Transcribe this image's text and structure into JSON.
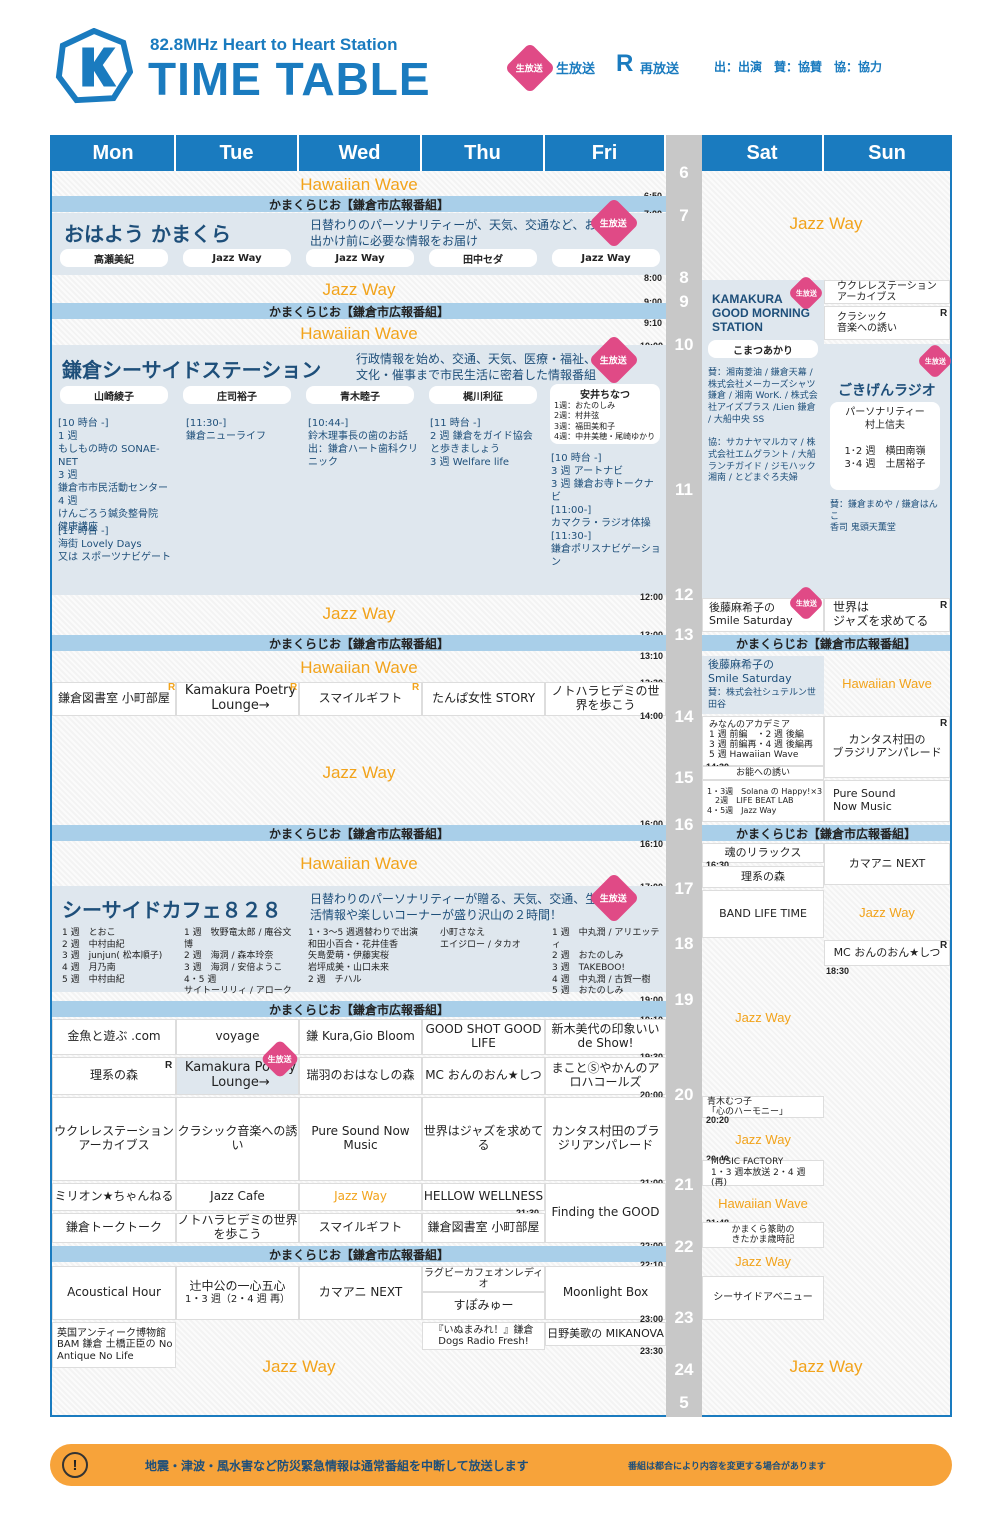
{
  "header": {
    "station": "82.8MHz Heart to Heart Station",
    "title": "TIME TABLE"
  },
  "legend": {
    "live_badge": "生放送",
    "live": "生放送",
    "rerun_mark": "R",
    "rerun": "再放送",
    "credits": "出：出演　賛：協賛　協：協力"
  },
  "days": [
    "Mon",
    "Tue",
    "Wed",
    "Thu",
    "Fri",
    "Sat",
    "Sun"
  ],
  "hours": [
    "6",
    "7",
    "8",
    "9",
    "10",
    "11",
    "12",
    "13",
    "14",
    "15",
    "16",
    "17",
    "18",
    "19",
    "20",
    "21",
    "22",
    "23",
    "24",
    "5"
  ],
  "times": {
    "t650": "6:50",
    "t700": "7:00",
    "t800": "8:00",
    "t900": "9:00",
    "t910": "9:10",
    "t1000": "10:00",
    "t1200": "12:00",
    "t1300": "13:00",
    "t1310": "13:10",
    "t1330": "13:30",
    "t1400": "14:00",
    "t1600": "16:00",
    "t1610": "16:10",
    "t1700": "17:00",
    "t1900": "19:00",
    "t1910": "19:10",
    "t1930": "19:30",
    "t2000": "20:00",
    "t2100": "21:00",
    "t2130": "21:30",
    "t2200": "22:00",
    "t2210": "22:10",
    "t2300": "23:00",
    "t2330": "23:30",
    "sat1430": "14:30",
    "sat1630": "16:30",
    "sun1830": "18:30",
    "sat2020": "20:20",
    "sat2040": "20:40",
    "sat2148": "21:48"
  },
  "common": {
    "hawaiian": "Hawaiian Wave",
    "jazz": "Jazz Way",
    "koho": "かまくらじお【鎌倉市広報番組】"
  },
  "morning": {
    "title": "おはよう かまくら",
    "desc": "日替わりのパーソナリティーが、天気、交通など、お出かけ前に必要な情報をお届け",
    "hosts": [
      "高瀬美紀",
      "Jazz Way",
      "Jazz Way",
      "田中セダ",
      "Jazz Way"
    ]
  },
  "seaside": {
    "title": "鎌倉シーサイドステーション",
    "desc": "行政情報を始め、交通、天気、医療・福祉、文化・催事まで市民生活に密着した情報番組",
    "hosts": [
      "山崎綾子",
      "庄司裕子",
      "青木睦子",
      "梶川利征",
      "安井ちなつ"
    ],
    "fri_weeks": "1週：おたのしみ\n2週：村井弦\n3週：福田美和子\n4週：中井美穂・尾崎ゆかり",
    "mon": "[10 時台 -]\n1 週\nもしもの時の SONAE-NET\n3 週\n鎌倉市市民活動センター\n4 週\nけんごろう鍼灸整骨院\n健康講座",
    "mon2": "[11 時台 -]\n海街 Lovely Days\n又は スポーツナビゲート",
    "tue": "[11:30-]\n鎌倉ニューライフ",
    "wed": "[10:44-]\n鈴木理事長の歯のお話\n出：鎌倉ハート歯科クリニック",
    "thu": "[11 時台 -]\n2 週 鎌倉をガイド協会と歩きましょう\n3 週 Welfare life",
    "fri": "[10 時台 -]\n3 週 アートナビ\n3 週 鎌倉お寺トークナビ\n[11:00-]\nカマクラ・ラジオ体操\n[11:30-]\n鎌倉ポリスナビゲーション"
  },
  "afternoon": {
    "mon": "鎌倉図書室 小町部屋",
    "tue": "Kamakura Poetry Lounge→",
    "wed": "スマイルギフト",
    "thu": "たんぱ女性 STORY",
    "fri": "ノトハラヒデミの世界を歩こう"
  },
  "cafe": {
    "title": "シーサイドカフェ８２８",
    "desc": "日替わりのパーソナリティーが贈る、天気、交通、生活情報や楽しいコーナーが盛り沢山の２時間！",
    "mon": "1 週　とおこ\n2 週　中村由紀\n3 週　junjun( 松本順子)\n4 週　月乃南\n5 週　中村由紀",
    "tue": "1 週　牧野竜太郎 / 庵谷文博\n2 週　海洞 / 森本玲奈\n3 週　海洞 / 安倍ようこ\n4・5 週\nサイトーリリィ / アローク",
    "wed": "1・3～5 週週替わりで出演\n和田小百合・花井佳香\n矢島愛萌・伊藤実桜\n岩坪成美・山口未来\n2 週　チハル",
    "thu": "小町さなえ\nエイジロー / タカオ",
    "fri": "1 週　中丸潤 / アリエッティ\n2 週　おたのしみ\n3 週　TAKEBOO!\n4 週　中丸潤 / 古賀一樹\n5 週　おたのしみ"
  },
  "evening": {
    "r1": [
      "金魚と遊ぶ .com",
      "voyage",
      "鎌 Kura,Gio Bloom",
      "GOOD SHOT GOOD LIFE",
      "新木美代の印象いいde Show!"
    ],
    "r2": [
      "理系の森",
      "Kamakura Poetry Lounge→",
      "瑞羽のおはなしの森",
      "MC おんのおん★しつ",
      "まことⓈやかんのアロハコールズ"
    ],
    "r3": [
      "ウクレレステーションアーカイブス",
      "クラシック音楽への誘い",
      "Pure Sound Now Music",
      "世界はジャズを求めてる",
      "カンタス村田のブラジリアンパレード"
    ],
    "r4": [
      "ミリオン★ちゃんねる",
      "Jazz Cafe",
      "Jazz Way",
      "HELLOW WELLNESS",
      "Finding the GOOD"
    ],
    "r5": [
      "鎌倉トークトーク",
      "ノトハラヒデミの世界を歩こう",
      "スマイルギフト",
      "鎌倉図書室 小町部屋"
    ],
    "r6": [
      "Acoustical Hour",
      "辻中公の一心五心",
      "カマアニ NEXT",
      "ラグビーカフェオンレディオ",
      "Moonlight Box"
    ],
    "tue_sub": "1・3 週（2・4 週 再）",
    "thu2": "すぽみゅー",
    "r7": [
      "英国アンティーク博物館 BAM 鎌倉 土橋正臣の No Antique No Life",
      "『いぬまみれ！』鎌倉 Dogs Radio Fresh!",
      "日野美歌の MIKANOVA"
    ]
  },
  "sat": {
    "kgm": "KAMAKURA GOOD MORNING STATION",
    "kgm_host": "こまつあかり",
    "kgm_spon": "賛：湘南菱油 / 鎌倉天幕 / 株式会社メーカーズシャツ鎌倉 / 湘南 WorK. / 株式会社アイズプラス /Lien 鎌倉 / 大船中央 SS\n\n協：サカナヤマルカマ / 株式会社エムグラント / 大船ランチガイド / ジモハック湘南 / とどまぐろ夫婦",
    "smile1": "後藤麻希子の\nSmile Saturday",
    "smile2": "後藤麻希子の\nSmile Saturday",
    "smile_spon": "賛：株式会社シュテルン世田谷",
    "academy": "みなんのアカデミア\n1 週 前編　・2 週 後編\n3 週 前編再・4 週 後編再\n5 週 Hawaiian Wave",
    "noh": "お能への誘い",
    "solana": "1・3週　Solana の Happy!×3\n　2週　LIFE BEAT LAB\n4・5週　Jazz Way",
    "relax": "魂のリラックス",
    "rikei": "理系の森",
    "band": "BAND LIFE TIME",
    "aoki": "青木むつ子\n「心のハーモニー」",
    "mf": "MUSIC FACTORY\n1・3 週本放送 2・4 週 (再)",
    "kizuna": "かまくら篆助の\nきたかま歳時記",
    "avenue": "シーサイドアベニュー"
  },
  "sun": {
    "uku": "ウクレレステーション\nアーカイブス",
    "classic": "クラシック\n音楽への誘い",
    "gokigen": "ごきげんラジオ",
    "gokigen_host": "パーソナリティー\n村上信夫\n\n1･2 週　横田南嶺\n3･4 週　土居裕子",
    "gokigen_spon": "賛：鎌倉まめや / 鎌倉はんこ\n香司 鬼頭天薫堂",
    "jazz_world": "世界は\nジャズを求めてる",
    "cantas": "カンタス村田の\nブラジリアンパレード",
    "pure": "Pure Sound\nNow Music",
    "kamaani": "カマアニ NEXT",
    "mc": "MC おんのおん★しつ"
  },
  "footer": {
    "notice": "地震・津波・風水害など防災緊急情報は通常番組を中断して放送します",
    "note": "番組は都合により内容を変更する場合があります",
    "icon": "!"
  }
}
